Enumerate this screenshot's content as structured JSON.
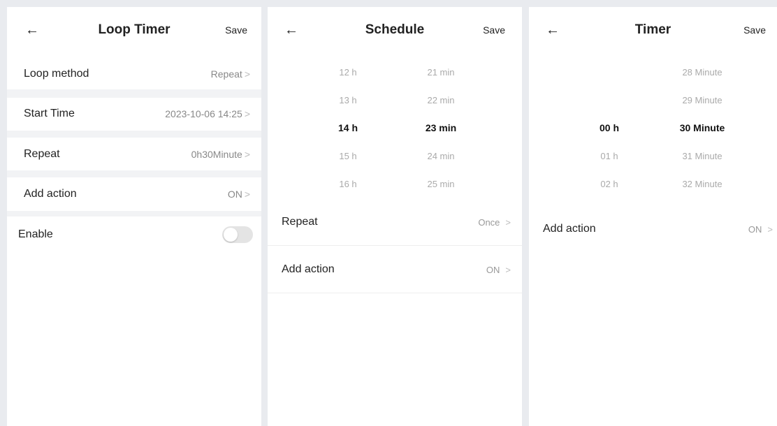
{
  "loop_timer": {
    "title": "Loop Timer",
    "save": "Save",
    "rows": [
      {
        "label": "Loop method",
        "value": "Repeat",
        "chev": ">"
      },
      {
        "label": "Start Time",
        "value": "2023-10-06 14:25",
        "chev": ">"
      },
      {
        "label": "Repeat",
        "value": "0h30Minute",
        "chev": ">"
      },
      {
        "label": "Add action",
        "value": "ON",
        "chev": ">"
      }
    ],
    "enable_label": "Enable",
    "enable_on": false
  },
  "schedule": {
    "title": "Schedule",
    "save": "Save",
    "hours": [
      "12 h",
      "13 h",
      "14 h",
      "15 h",
      "16 h"
    ],
    "minutes": [
      "21 min",
      "22 min",
      "23 min",
      "24 min",
      "25 min"
    ],
    "rows": [
      {
        "label": "Repeat",
        "value": "Once",
        "chev": ">"
      },
      {
        "label": "Add action",
        "value": "ON",
        "chev": ">"
      }
    ]
  },
  "timer": {
    "title": "Timer",
    "save": "Save",
    "hours": [
      "00 h",
      "01 h",
      "02 h"
    ],
    "minutes": [
      "28 Minute",
      "29 Minute",
      "30 Minute",
      "31 Minute",
      "32 Minute"
    ],
    "rows": [
      {
        "label": "Add action",
        "value": "ON",
        "chev": ">"
      }
    ]
  }
}
